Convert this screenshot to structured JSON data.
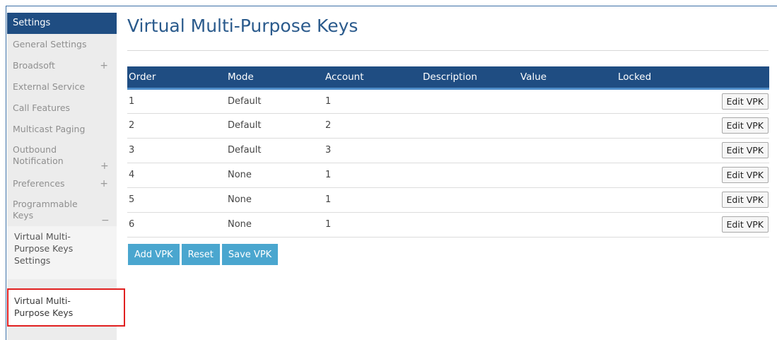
{
  "sidebar": {
    "header": "Settings",
    "items": [
      {
        "label": "General Settings",
        "expand": ""
      },
      {
        "label": "Broadsoft",
        "expand": "+"
      },
      {
        "label": "External Service",
        "expand": ""
      },
      {
        "label": "Call Features",
        "expand": ""
      },
      {
        "label": "Multicast Paging",
        "expand": ""
      },
      {
        "label": "Outbound Notification",
        "expand": "+"
      },
      {
        "label": "Preferences",
        "expand": "+"
      },
      {
        "label": "Programmable Keys",
        "expand": "−"
      }
    ],
    "sub_items": [
      "Virtual Multi-Purpose Keys Settings"
    ],
    "active_item": "Virtual Multi-Purpose Keys"
  },
  "page_title": "Virtual Multi-Purpose Keys",
  "table": {
    "columns": [
      "Order",
      "Mode",
      "Account",
      "Description",
      "Value",
      "Locked"
    ],
    "rows": [
      {
        "order": "1",
        "mode": "Default",
        "account": "1",
        "description": "",
        "value": "",
        "locked": "",
        "action": "Edit VPK"
      },
      {
        "order": "2",
        "mode": "Default",
        "account": "2",
        "description": "",
        "value": "",
        "locked": "",
        "action": "Edit VPK"
      },
      {
        "order": "3",
        "mode": "Default",
        "account": "3",
        "description": "",
        "value": "",
        "locked": "",
        "action": "Edit VPK"
      },
      {
        "order": "4",
        "mode": "None",
        "account": "1",
        "description": "",
        "value": "",
        "locked": "",
        "action": "Edit VPK"
      },
      {
        "order": "5",
        "mode": "None",
        "account": "1",
        "description": "",
        "value": "",
        "locked": "",
        "action": "Edit VPK"
      },
      {
        "order": "6",
        "mode": "None",
        "account": "1",
        "description": "",
        "value": "",
        "locked": "",
        "action": "Edit VPK"
      }
    ]
  },
  "buttons": {
    "add": "Add VPK",
    "reset": "Reset",
    "save": "Save VPK"
  },
  "colors": {
    "header_blue": "#1f4d82",
    "button_blue": "#4aa6cf",
    "highlight_red": "#e02020"
  }
}
